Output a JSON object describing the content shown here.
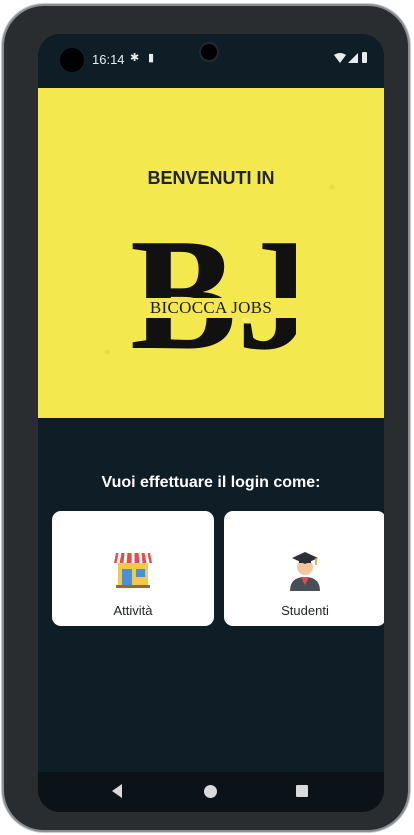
{
  "status_bar": {
    "time": "16:14",
    "left_icons": [
      "gear-icon",
      "sd-card-icon"
    ],
    "right_icons": [
      "wifi-icon",
      "signal-icon",
      "battery-icon"
    ]
  },
  "banner": {
    "welcome": "BENVENUTI IN",
    "logo_letters": "BJ",
    "logo_text": "BICOCCA JOBS",
    "background_color": "#f3e84d"
  },
  "login": {
    "question": "Vuoi effettuare il login come:",
    "options": [
      {
        "label": "Attività",
        "icon": "storefront-icon"
      },
      {
        "label": "Studenti",
        "icon": "graduate-student-icon"
      }
    ]
  },
  "nav_bar": {
    "buttons": [
      "back-icon",
      "home-icon",
      "recents-icon"
    ]
  },
  "colors": {
    "screen_background": "#0f1d26",
    "card_background": "#ffffff"
  }
}
